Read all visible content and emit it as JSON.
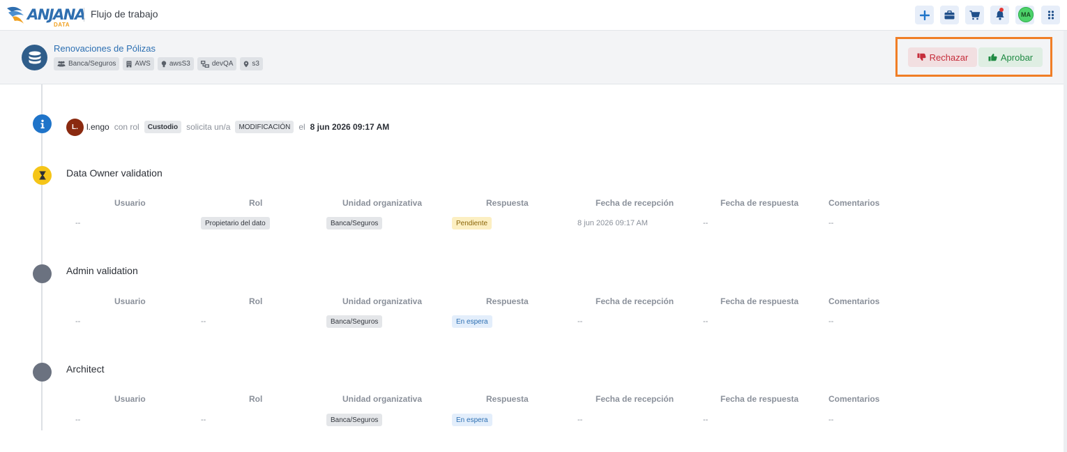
{
  "app": {
    "logo_text": "ANJANA",
    "logo_sub": "DATA",
    "title": "Flujo de trabajo",
    "user_initials": "MA"
  },
  "nav_icons": [
    "plus-icon",
    "briefcase-icon",
    "cart-icon",
    "bell-icon",
    "avatar",
    "apps-icon"
  ],
  "header": {
    "title": "Renovaciones de Pólizas",
    "chips": [
      {
        "icon": "users-icon",
        "label": "Banca/Seguros"
      },
      {
        "icon": "building-icon",
        "label": "AWS"
      },
      {
        "icon": "bulb-icon",
        "label": "awsS3"
      },
      {
        "icon": "network-icon",
        "label": "devQA"
      },
      {
        "icon": "pin-icon",
        "label": "s3"
      }
    ],
    "reject_label": "Rechazar",
    "approve_label": "Aprobar"
  },
  "request": {
    "avatar_initials": "L.",
    "user": "l.engo",
    "with_role_text": "con rol",
    "role": "Custodio",
    "requests_text": "solicita un/a",
    "type": "MODIFICACIÓN",
    "on_text": "el",
    "date": "8 jun 2026 09:17 AM"
  },
  "columns": [
    "Usuario",
    "Rol",
    "Unidad organizativa",
    "Respuesta",
    "Fecha de recepción",
    "Fecha de respuesta",
    "Comentarios"
  ],
  "steps": [
    {
      "title": "Data Owner validation",
      "status": "pending",
      "row": {
        "usuario": "--",
        "rol": "Propietario del dato",
        "unidad": "Banca/Seguros",
        "respuesta": "Pendiente",
        "fecha_recepcion": "8 jun 2026 09:17 AM",
        "fecha_respuesta": "--",
        "comentarios": "--"
      }
    },
    {
      "title": "Admin validation",
      "status": "waiting",
      "row": {
        "usuario": "--",
        "rol": "--",
        "unidad": "Banca/Seguros",
        "respuesta": "En espera",
        "fecha_recepcion": "--",
        "fecha_respuesta": "--",
        "comentarios": "--"
      }
    },
    {
      "title": "Architect",
      "status": "waiting",
      "row": {
        "usuario": "--",
        "rol": "--",
        "unidad": "Banca/Seguros",
        "respuesta": "En espera",
        "fecha_recepcion": "--",
        "fecha_respuesta": "--",
        "comentarios": "--"
      }
    }
  ],
  "colors": {
    "accent": "#2c6fb2",
    "reject": "#c62d3b",
    "approve": "#1f8a43",
    "highlight_frame": "#f07e26",
    "pending_step": "#f5c518",
    "info_step": "#1f74c9",
    "waiting_step": "#6b7280"
  }
}
